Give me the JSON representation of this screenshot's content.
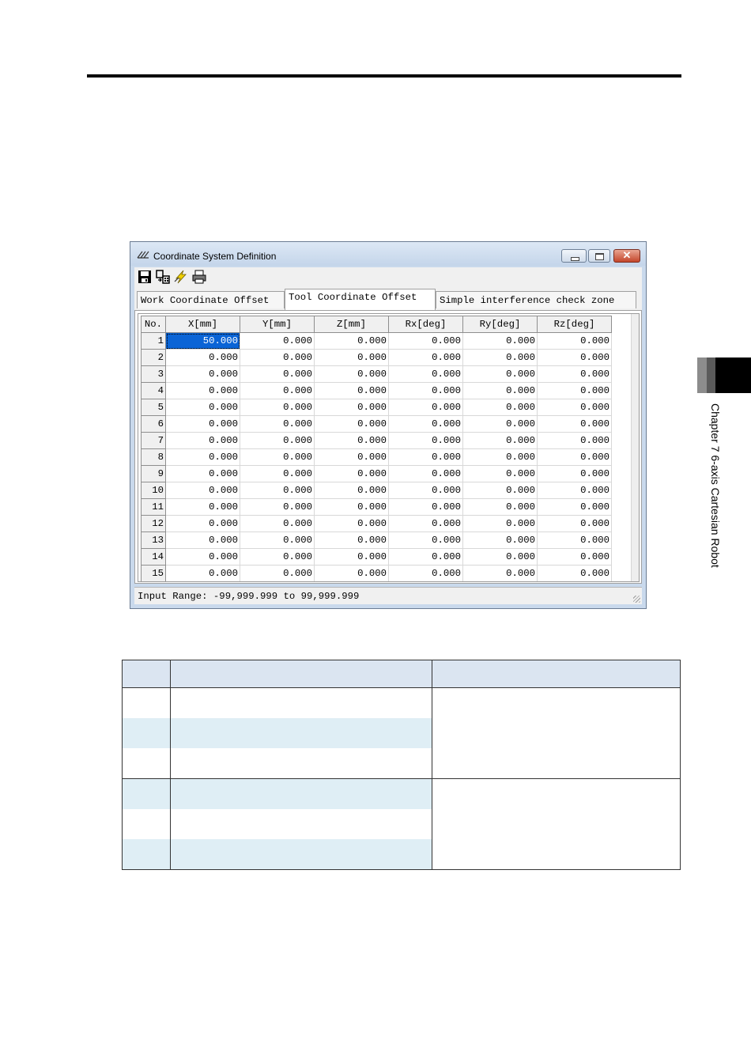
{
  "side_label": "Chapter 7 6-axis Cartesian Robot",
  "window": {
    "title": "Coordinate System Definition",
    "toolbar_icons": [
      "save-icon",
      "transfer-icon",
      "lightning-icon",
      "print-icon"
    ],
    "tabs": [
      {
        "label": "Work Coordinate Offset",
        "active": false
      },
      {
        "label": "Tool Coordinate Offset",
        "active": true
      },
      {
        "label": "Simple interference check zone",
        "active": false
      }
    ],
    "grid": {
      "headers": [
        "No.",
        "X[mm]",
        "Y[mm]",
        "Z[mm]",
        "Rx[deg]",
        "Ry[deg]",
        "Rz[deg]"
      ],
      "rows": [
        [
          "1",
          "50.000",
          "0.000",
          "0.000",
          "0.000",
          "0.000",
          "0.000"
        ],
        [
          "2",
          "0.000",
          "0.000",
          "0.000",
          "0.000",
          "0.000",
          "0.000"
        ],
        [
          "3",
          "0.000",
          "0.000",
          "0.000",
          "0.000",
          "0.000",
          "0.000"
        ],
        [
          "4",
          "0.000",
          "0.000",
          "0.000",
          "0.000",
          "0.000",
          "0.000"
        ],
        [
          "5",
          "0.000",
          "0.000",
          "0.000",
          "0.000",
          "0.000",
          "0.000"
        ],
        [
          "6",
          "0.000",
          "0.000",
          "0.000",
          "0.000",
          "0.000",
          "0.000"
        ],
        [
          "7",
          "0.000",
          "0.000",
          "0.000",
          "0.000",
          "0.000",
          "0.000"
        ],
        [
          "8",
          "0.000",
          "0.000",
          "0.000",
          "0.000",
          "0.000",
          "0.000"
        ],
        [
          "9",
          "0.000",
          "0.000",
          "0.000",
          "0.000",
          "0.000",
          "0.000"
        ],
        [
          "10",
          "0.000",
          "0.000",
          "0.000",
          "0.000",
          "0.000",
          "0.000"
        ],
        [
          "11",
          "0.000",
          "0.000",
          "0.000",
          "0.000",
          "0.000",
          "0.000"
        ],
        [
          "12",
          "0.000",
          "0.000",
          "0.000",
          "0.000",
          "0.000",
          "0.000"
        ],
        [
          "13",
          "0.000",
          "0.000",
          "0.000",
          "0.000",
          "0.000",
          "0.000"
        ],
        [
          "14",
          "0.000",
          "0.000",
          "0.000",
          "0.000",
          "0.000",
          "0.000"
        ],
        [
          "15",
          "0.000",
          "0.000",
          "0.000",
          "0.000",
          "0.000",
          "0.000"
        ]
      ]
    },
    "status": "Input Range: -99,999.999 to 99,999.999"
  },
  "colors": {
    "selection": "#0a64d6",
    "table_header": "#dbe5f1",
    "table_shade": "#dfeef5"
  }
}
